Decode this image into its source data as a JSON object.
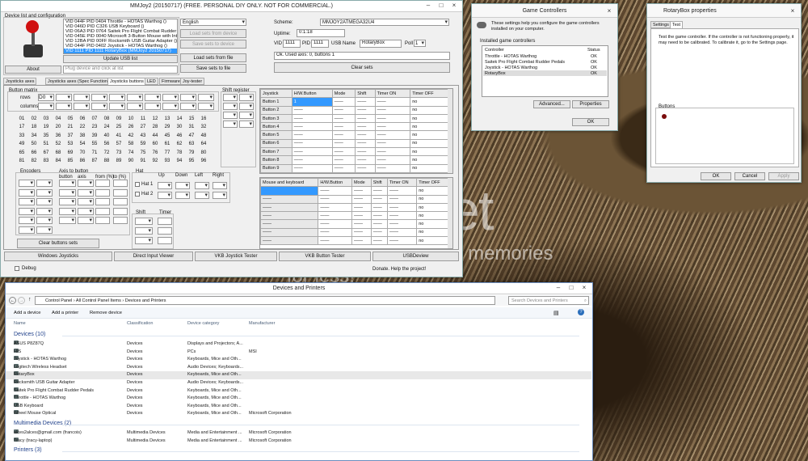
{
  "watermark": {
    "brand": "photobucket",
    "tagline": "Protect more of your memories for less!"
  },
  "mmjoy": {
    "title": "MMJoy2 (20150717) (FREE. PERSONAL DIY ONLY. NOT FOR COMMERCIAL.)",
    "device_list_label": "Device list and configuration",
    "devices": [
      "VID 044F PID 0404 Throttle - HOTAS Warthog ()",
      "VID 046D PID C326 USB Keyboard ()",
      "VID 06A3 PID 0764 Saitek Pro Flight Combat Rudder Pedals ()",
      "VID 045E PID 0040 Microsoft 3-Button Mouse with IntelliEye()",
      "VID 12BA PID 00FF Rocksmith USB Guitar Adapter ()",
      "VID 044F PID 0402 Joystick - HOTAS Warthog ()",
      "VID 1111 PID 1111 RotaryBox (MMJoy2 20150717)"
    ],
    "about": "About",
    "update_usb": "Update USB list",
    "plug_hint": "Plug device and click at list",
    "language": "English",
    "load_from_device": "Load sets from device",
    "save_to_device": "Save sets to device",
    "load_from_file": "Load sets from file",
    "save_to_file": "Save sets to file",
    "scheme_label": "Scheme:",
    "scheme": "MMJOY2ATMEGA32U4",
    "uptime_label": "Uptime:",
    "uptime": "0:1:18",
    "vid_label": "VID",
    "vid": "1111",
    "pid_label": "PID",
    "pid": "1111",
    "usbname_label": "USB Name",
    "usbname": "RotaryBox",
    "poll_label": "Poll",
    "poll": "1",
    "status": "Ok. Used axis: 0, buttons 1",
    "clear_sets": "Clear sets",
    "tabs": [
      "Joysticks axes",
      "Joysticks axes (Spec Functions)",
      "Joysticks buttons",
      "LED",
      "Firmware",
      "Joy-tester"
    ],
    "matrix_label": "Button matrix",
    "rows_label": "rows",
    "cols_label": "columns",
    "rows_val": "D0",
    "shift_register": "Shift register",
    "button_numbers": [
      "01",
      "02",
      "03",
      "04",
      "05",
      "06",
      "07",
      "08",
      "09",
      "10",
      "11",
      "12",
      "13",
      "14",
      "15",
      "16",
      "17",
      "18",
      "19",
      "20",
      "21",
      "22",
      "23",
      "24",
      "25",
      "26",
      "27",
      "28",
      "29",
      "30",
      "31",
      "32",
      "33",
      "34",
      "35",
      "36",
      "37",
      "38",
      "39",
      "40",
      "41",
      "42",
      "43",
      "44",
      "45",
      "46",
      "47",
      "48",
      "49",
      "50",
      "51",
      "52",
      "53",
      "54",
      "55",
      "56",
      "57",
      "58",
      "59",
      "60",
      "61",
      "62",
      "63",
      "64",
      "65",
      "66",
      "67",
      "68",
      "69",
      "70",
      "71",
      "72",
      "73",
      "74",
      "75",
      "76",
      "77",
      "78",
      "79",
      "80",
      "81",
      "82",
      "83",
      "84",
      "85",
      "86",
      "87",
      "88",
      "89",
      "90",
      "91",
      "92",
      "93",
      "94",
      "95",
      "96"
    ],
    "encoders": "Encoders",
    "axis_to_button": "Axis to button",
    "enc_cols": [
      "button",
      "axis",
      "from (%)",
      "to (%)"
    ],
    "hat": "Hat",
    "hat_cols": [
      "Up",
      "Down",
      "Left",
      "Right"
    ],
    "hat1": "Hat 1",
    "hat2": "Hat 2",
    "shift": "Shift",
    "timer": "Timer",
    "clear_buttons": "Clear buttons sets",
    "joy_headers": [
      "Joystick",
      "H/W.Button",
      "Mode",
      "Shift",
      "Timer ON",
      "Timer OFF"
    ],
    "joy_rows": [
      "Button 1",
      "Button 2",
      "Button 3",
      "Button 4",
      "Button 5",
      "Button 6",
      "Button 7",
      "Button 8",
      "Button 9"
    ],
    "joy_first_hw": "1",
    "dash": "——",
    "no": "no",
    "mk_headers": [
      "Mouse and keyboard",
      "H/W.Button",
      "Mode",
      "Shift",
      "Timer ON",
      "Timer OFF"
    ],
    "bottom_buttons": [
      "Windows Joysticks",
      "Direct Input Viewer",
      "VKB Joystick Tester",
      "VKB Button Tester",
      "USBDeview"
    ],
    "debug": "Debug",
    "donate": "Donate. Help the project!"
  },
  "gamectl": {
    "title": "Game Controllers",
    "desc": "These settings help you configure the game controllers installed on your computer.",
    "installed": "Installed game controllers",
    "col_controller": "Controller",
    "col_status": "Status",
    "rows": [
      {
        "name": "Throttle - HOTAS Warthog",
        "status": "OK"
      },
      {
        "name": "Saitek Pro Flight Combat Rudder Pedals",
        "status": "OK"
      },
      {
        "name": "Joystick - HOTAS Warthog",
        "status": "OK"
      },
      {
        "name": "RotaryBox",
        "status": "OK"
      }
    ],
    "advanced": "Advanced...",
    "properties": "Properties",
    "ok": "OK"
  },
  "rotary": {
    "title": "RotaryBox properties",
    "tabs": [
      "Settings",
      "Test"
    ],
    "desc": "Test the game controller. If the controller is not functioning properly, it may need to be calibrated. To calibrate it, go to the Settings page.",
    "buttons_label": "Buttons",
    "ok": "OK",
    "cancel": "Cancel",
    "apply": "Apply"
  },
  "devices": {
    "title": "Devices and Printers",
    "breadcrumb": [
      "Control Panel",
      "All Control Panel Items",
      "Devices and Printers"
    ],
    "search_placeholder": "Search Devices and Printers",
    "toolbar": [
      "Add a device",
      "Add a printer",
      "Remove device"
    ],
    "cols": [
      "Name",
      "Classification",
      "Device category",
      "Manufacturer"
    ],
    "groups": [
      {
        "label": "Devices (10)",
        "rows": [
          [
            "ASUS P8Z87Q",
            "Devices",
            "Displays and Projectors; A...",
            ""
          ],
          [
            "HIS",
            "Devices",
            "PCs",
            "MSI"
          ],
          [
            "Joystick - HOTAS Warthog",
            "Devices",
            "Keyboards, Mice and Oth...",
            ""
          ],
          [
            "Logitech Wireless Headset",
            "Devices",
            "Audio Devices; Keyboards...",
            ""
          ],
          [
            "RotaryBox",
            "Devices",
            "Keyboards, Mice and Oth...",
            ""
          ],
          [
            "Rocksmith USB Guitar Adapter",
            "Devices",
            "Audio Devices; Keyboards...",
            ""
          ],
          [
            "Saitek Pro Flight Combat Rudder Pedals",
            "Devices",
            "Keyboards, Mice and Oth...",
            ""
          ],
          [
            "Throttle - HOTAS Warthog",
            "Devices",
            "Keyboards, Mice and Oth...",
            ""
          ],
          [
            "USB Keyboard",
            "Devices",
            "Keyboards, Mice and Oth...",
            ""
          ],
          [
            "Wheel Mouse Optical",
            "Devices",
            "Keyboards, Mice and Oth...",
            "Microsoft Corporation"
          ]
        ]
      },
      {
        "label": "Multimedia Devices (2)",
        "rows": [
          [
            "alces2alces@gmail.com (francois)",
            "Multimedia Devices",
            "Media and Entertainment ...",
            "Microsoft Corporation"
          ],
          [
            "Tracy (tracy-laptop)",
            "Multimedia Devices",
            "Media and Entertainment ...",
            "Microsoft Corporation"
          ]
        ]
      },
      {
        "label": "Printers (3)",
        "rows": []
      }
    ]
  }
}
